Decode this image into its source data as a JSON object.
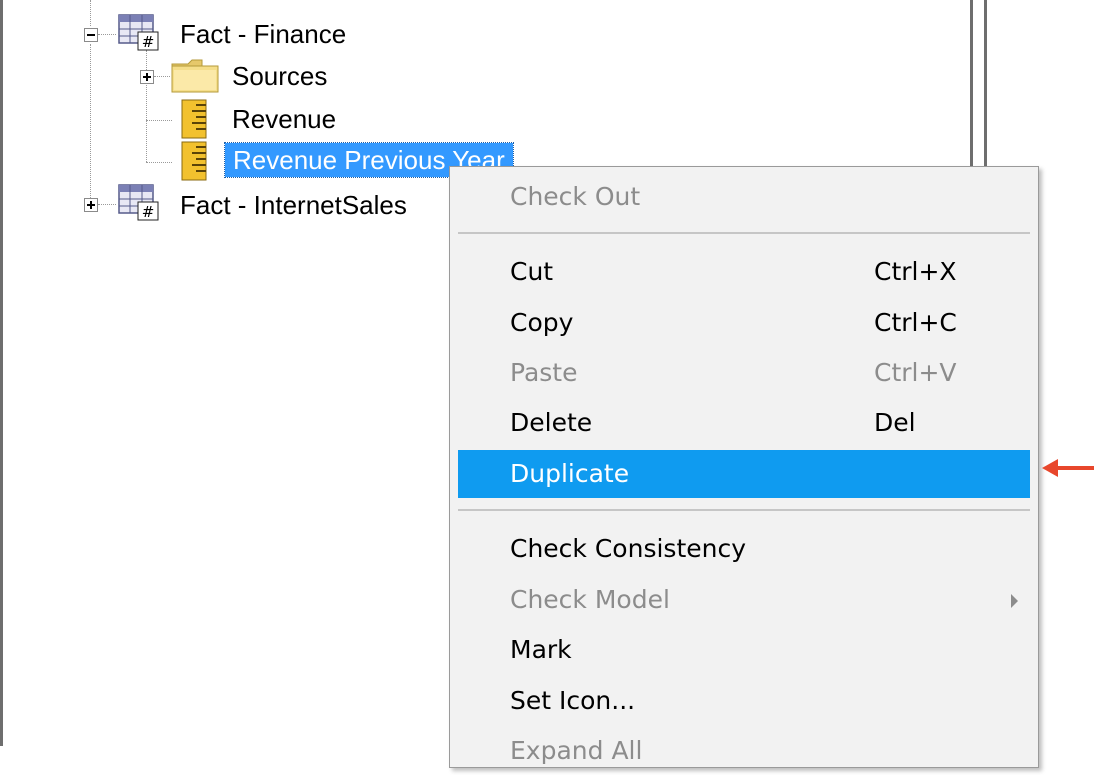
{
  "tree": {
    "items": [
      {
        "label": "Fact - Finance",
        "expander": "minus",
        "icon": "table-icon"
      },
      {
        "label": "Sources",
        "expander": "plus",
        "icon": "folder-icon"
      },
      {
        "label": "Revenue",
        "icon": "measure-icon"
      },
      {
        "label": "Revenue Previous Year",
        "icon": "measure-icon",
        "selected": true
      },
      {
        "label": "Fact - InternetSales",
        "expander": "plus",
        "icon": "table-icon"
      }
    ]
  },
  "context_menu": {
    "items": [
      {
        "label": "Check Out",
        "shortcut": "",
        "disabled": true
      },
      {
        "label": "Cut",
        "shortcut": "Ctrl+X"
      },
      {
        "label": "Copy",
        "shortcut": "Ctrl+C"
      },
      {
        "label": "Paste",
        "shortcut": "Ctrl+V",
        "disabled": true
      },
      {
        "label": "Delete",
        "shortcut": "Del"
      },
      {
        "label": "Duplicate",
        "shortcut": "",
        "highlighted": true
      },
      {
        "label": "Check Consistency",
        "shortcut": ""
      },
      {
        "label": "Check Model",
        "shortcut": "",
        "disabled": true,
        "submenu": true
      },
      {
        "label": "Mark",
        "shortcut": ""
      },
      {
        "label": "Set Icon...",
        "shortcut": ""
      },
      {
        "label": "Expand All",
        "shortcut": "",
        "partially_visible": true
      }
    ]
  },
  "colors": {
    "selection": "#3399ff",
    "menu_highlight": "#0f9bf0",
    "annotation_arrow": "#e8472c"
  }
}
